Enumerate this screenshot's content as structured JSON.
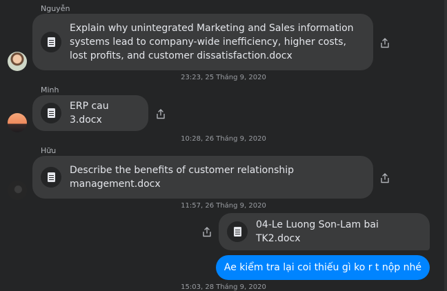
{
  "messages": [
    {
      "sender": "Nguyễn",
      "file_name": "Explain why unintegrated Marketing and Sales information systems lead to company-wide inefficiency, higher costs, lost profits, and customer dissatisfaction.docx",
      "timestamp": "23:23, 25 Tháng 9, 2020"
    },
    {
      "sender": "Minh",
      "file_name": "ERP cau 3.docx",
      "timestamp": "10:28, 26 Tháng 9, 2020"
    },
    {
      "sender": "Hữu",
      "file_name": "Describe the benefits of customer relationship management.docx",
      "timestamp": "11:57, 26 Tháng 9, 2020"
    },
    {
      "sender": "",
      "file_name": "04-Le Luong Son-Lam bai TK2.docx",
      "timestamp": ""
    }
  ],
  "outgoing_text": "Ae kiểm tra lại coi thiếu gì ko r t nộp nhé",
  "last_timestamp": "15:03, 28 Tháng 9, 2020",
  "icons": {
    "file": "document-icon",
    "share": "share-icon"
  },
  "colors": {
    "background": "#242526",
    "bubble": "#3a3b3c",
    "outgoing_bubble": "#0084ff",
    "text": "#e4e6eb",
    "meta": "#9a9da2"
  }
}
